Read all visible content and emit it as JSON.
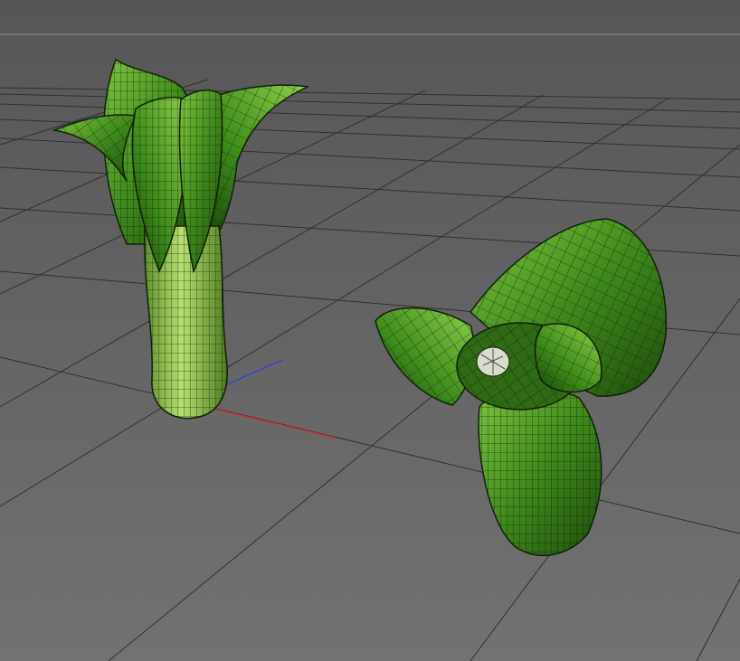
{
  "viewport": {
    "background_top": "#565656",
    "background_bottom": "#727272",
    "grid_color": "#2f2f2f",
    "horizon_color": "#8a8a8a"
  },
  "axes": {
    "x_color": "#c83232",
    "z_color": "#3246c8",
    "y_color": "#2ea84a"
  },
  "models": [
    {
      "name": "bok-choy-upright",
      "material_color": "#5aa030",
      "wire_color": "#0f1f08"
    },
    {
      "name": "bok-choy-lying",
      "material_color": "#5aa030",
      "wire_color": "#0f1f08"
    }
  ]
}
